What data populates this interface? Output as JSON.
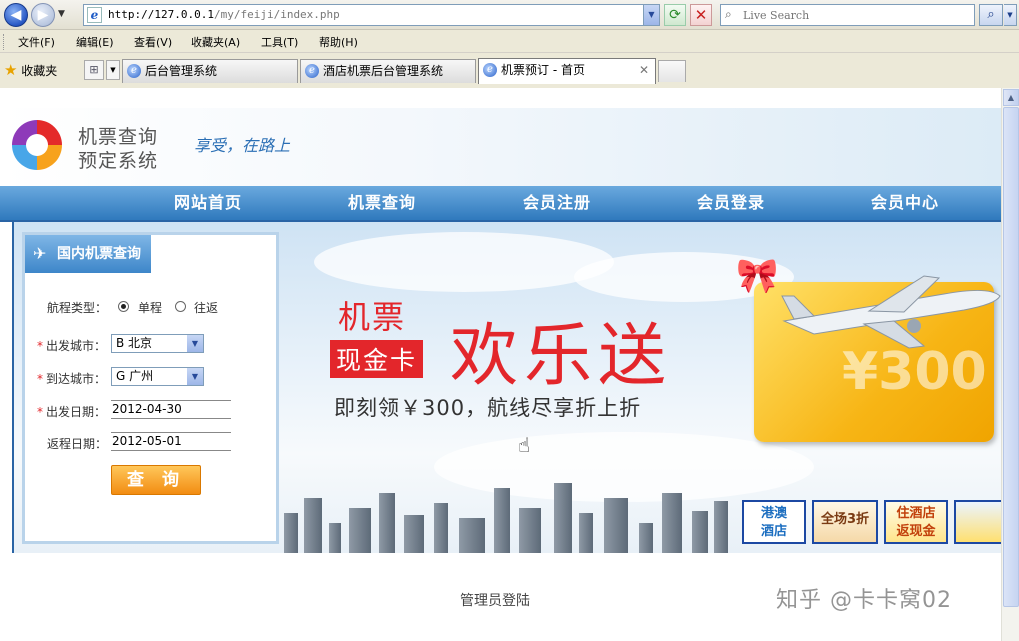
{
  "browser": {
    "url_prefix": "http://127.0.0.1",
    "url_path": "/my/feiji/index.php",
    "search_placeholder": "Live Search",
    "menu": [
      "文件(F)",
      "编辑(E)",
      "查看(V)",
      "收藏夹(A)",
      "工具(T)",
      "帮助(H)"
    ],
    "favorites_label": "收藏夹",
    "tabs": [
      {
        "title": "后台管理系统",
        "active": false
      },
      {
        "title": "酒店机票后台管理系统",
        "active": false
      },
      {
        "title": "机票预订 - 首页",
        "active": true
      }
    ]
  },
  "site": {
    "logo_line1": "机票查询",
    "logo_line2": "预定系统",
    "slogan": "享受，在路上",
    "nav": [
      "网站首页",
      "机票查询",
      "会员注册",
      "会员登录",
      "会员中心"
    ]
  },
  "banner": {
    "title_small": "机票",
    "title_badge": "现金卡",
    "title_big": "欢乐送",
    "subtitle": "即刻领￥300，航线尽享折上折",
    "card_amount": "¥300",
    "promos": [
      {
        "text": "港澳\n酒店"
      },
      {
        "text": "全场3折"
      },
      {
        "text": "住酒店\n返现金"
      }
    ]
  },
  "search_panel": {
    "tab_label": "国内机票查询",
    "trip_type_label": "航程类型：",
    "trip_one_way": "单程",
    "trip_round": "往返",
    "trip_selected": "单程",
    "from_label": "出发城市：",
    "from_value": "B 北京",
    "to_label": "到达城市：",
    "to_value": "G 广州",
    "depart_label": "出发日期：",
    "depart_value": "2012-04-30",
    "return_label": "返程日期：",
    "return_value": "2012-05-01",
    "submit_label": "查 询"
  },
  "footer": {
    "admin_login": "管理员登陆"
  },
  "watermark": "知乎 @卡卡窝02",
  "colors": {
    "nav_blue": "#3a82c4",
    "banner_red": "#e3262b",
    "button_orange": "#f28c12"
  }
}
